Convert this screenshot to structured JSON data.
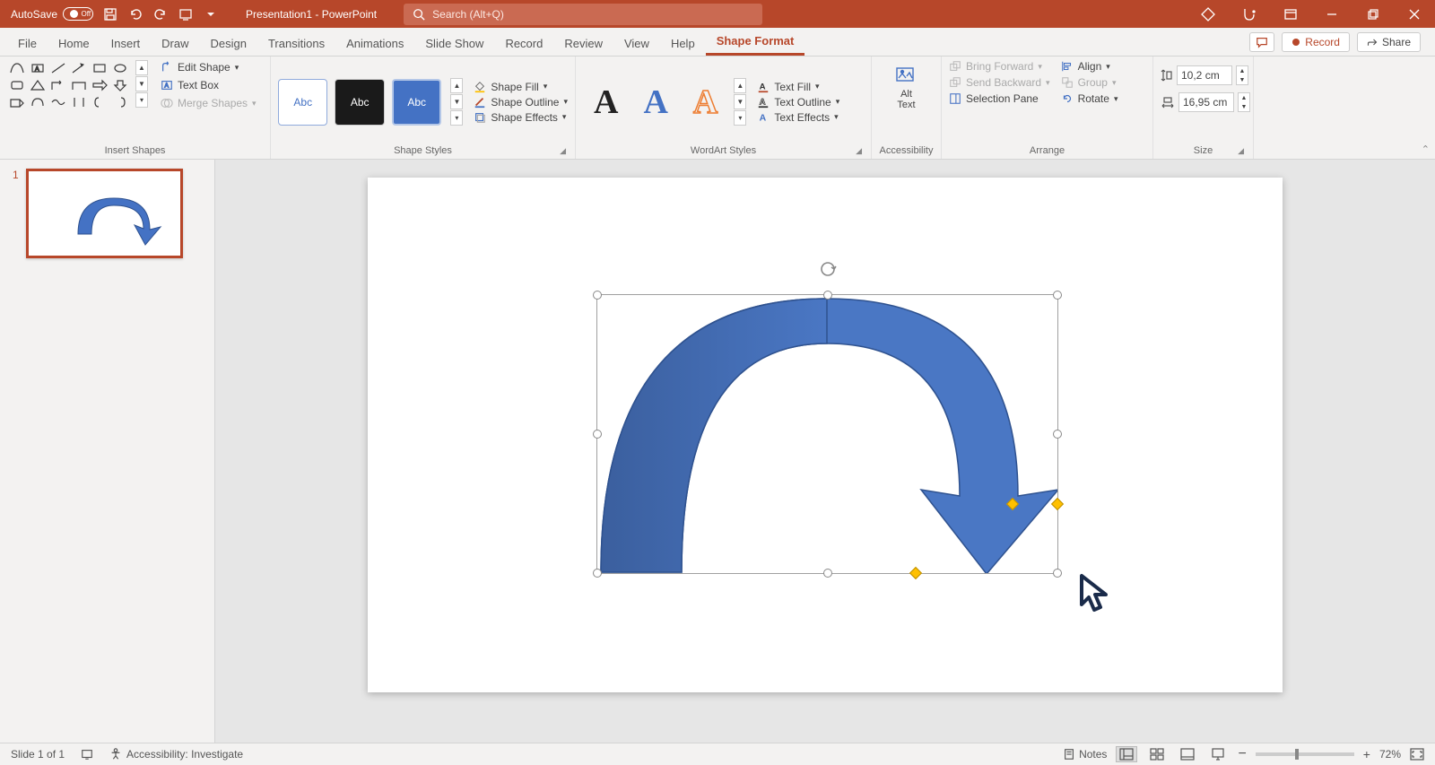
{
  "titlebar": {
    "autosave_label": "AutoSave",
    "autosave_state": "Off",
    "doc_title": "Presentation1 - PowerPoint",
    "search_placeholder": "Search (Alt+Q)"
  },
  "tabs": {
    "file": "File",
    "home": "Home",
    "insert": "Insert",
    "draw": "Draw",
    "design": "Design",
    "transitions": "Transitions",
    "animations": "Animations",
    "slideshow": "Slide Show",
    "record_tab": "Record",
    "review": "Review",
    "view": "View",
    "help": "Help",
    "shape_format": "Shape Format",
    "record_btn": "Record",
    "share_btn": "Share"
  },
  "ribbon": {
    "insert_shapes": {
      "label": "Insert Shapes",
      "edit_shape": "Edit Shape",
      "text_box": "Text Box",
      "merge_shapes": "Merge Shapes"
    },
    "shape_styles": {
      "label": "Shape Styles",
      "preset_text": "Abc",
      "shape_fill": "Shape Fill",
      "shape_outline": "Shape Outline",
      "shape_effects": "Shape Effects"
    },
    "wordart": {
      "label": "WordArt Styles",
      "text_fill": "Text Fill",
      "text_outline": "Text Outline",
      "text_effects": "Text Effects",
      "sample": "A"
    },
    "accessibility": {
      "label": "Accessibility",
      "alt_text": "Alt\nText"
    },
    "arrange": {
      "label": "Arrange",
      "bring_forward": "Bring Forward",
      "send_backward": "Send Backward",
      "selection_pane": "Selection Pane",
      "align": "Align",
      "group": "Group",
      "rotate": "Rotate"
    },
    "size": {
      "label": "Size",
      "height": "10,2 cm",
      "width": "16,95 cm"
    }
  },
  "thumbs": {
    "slide1_num": "1"
  },
  "statusbar": {
    "slide_info": "Slide 1 of 1",
    "accessibility": "Accessibility: Investigate",
    "notes": "Notes",
    "zoom": "72%"
  }
}
